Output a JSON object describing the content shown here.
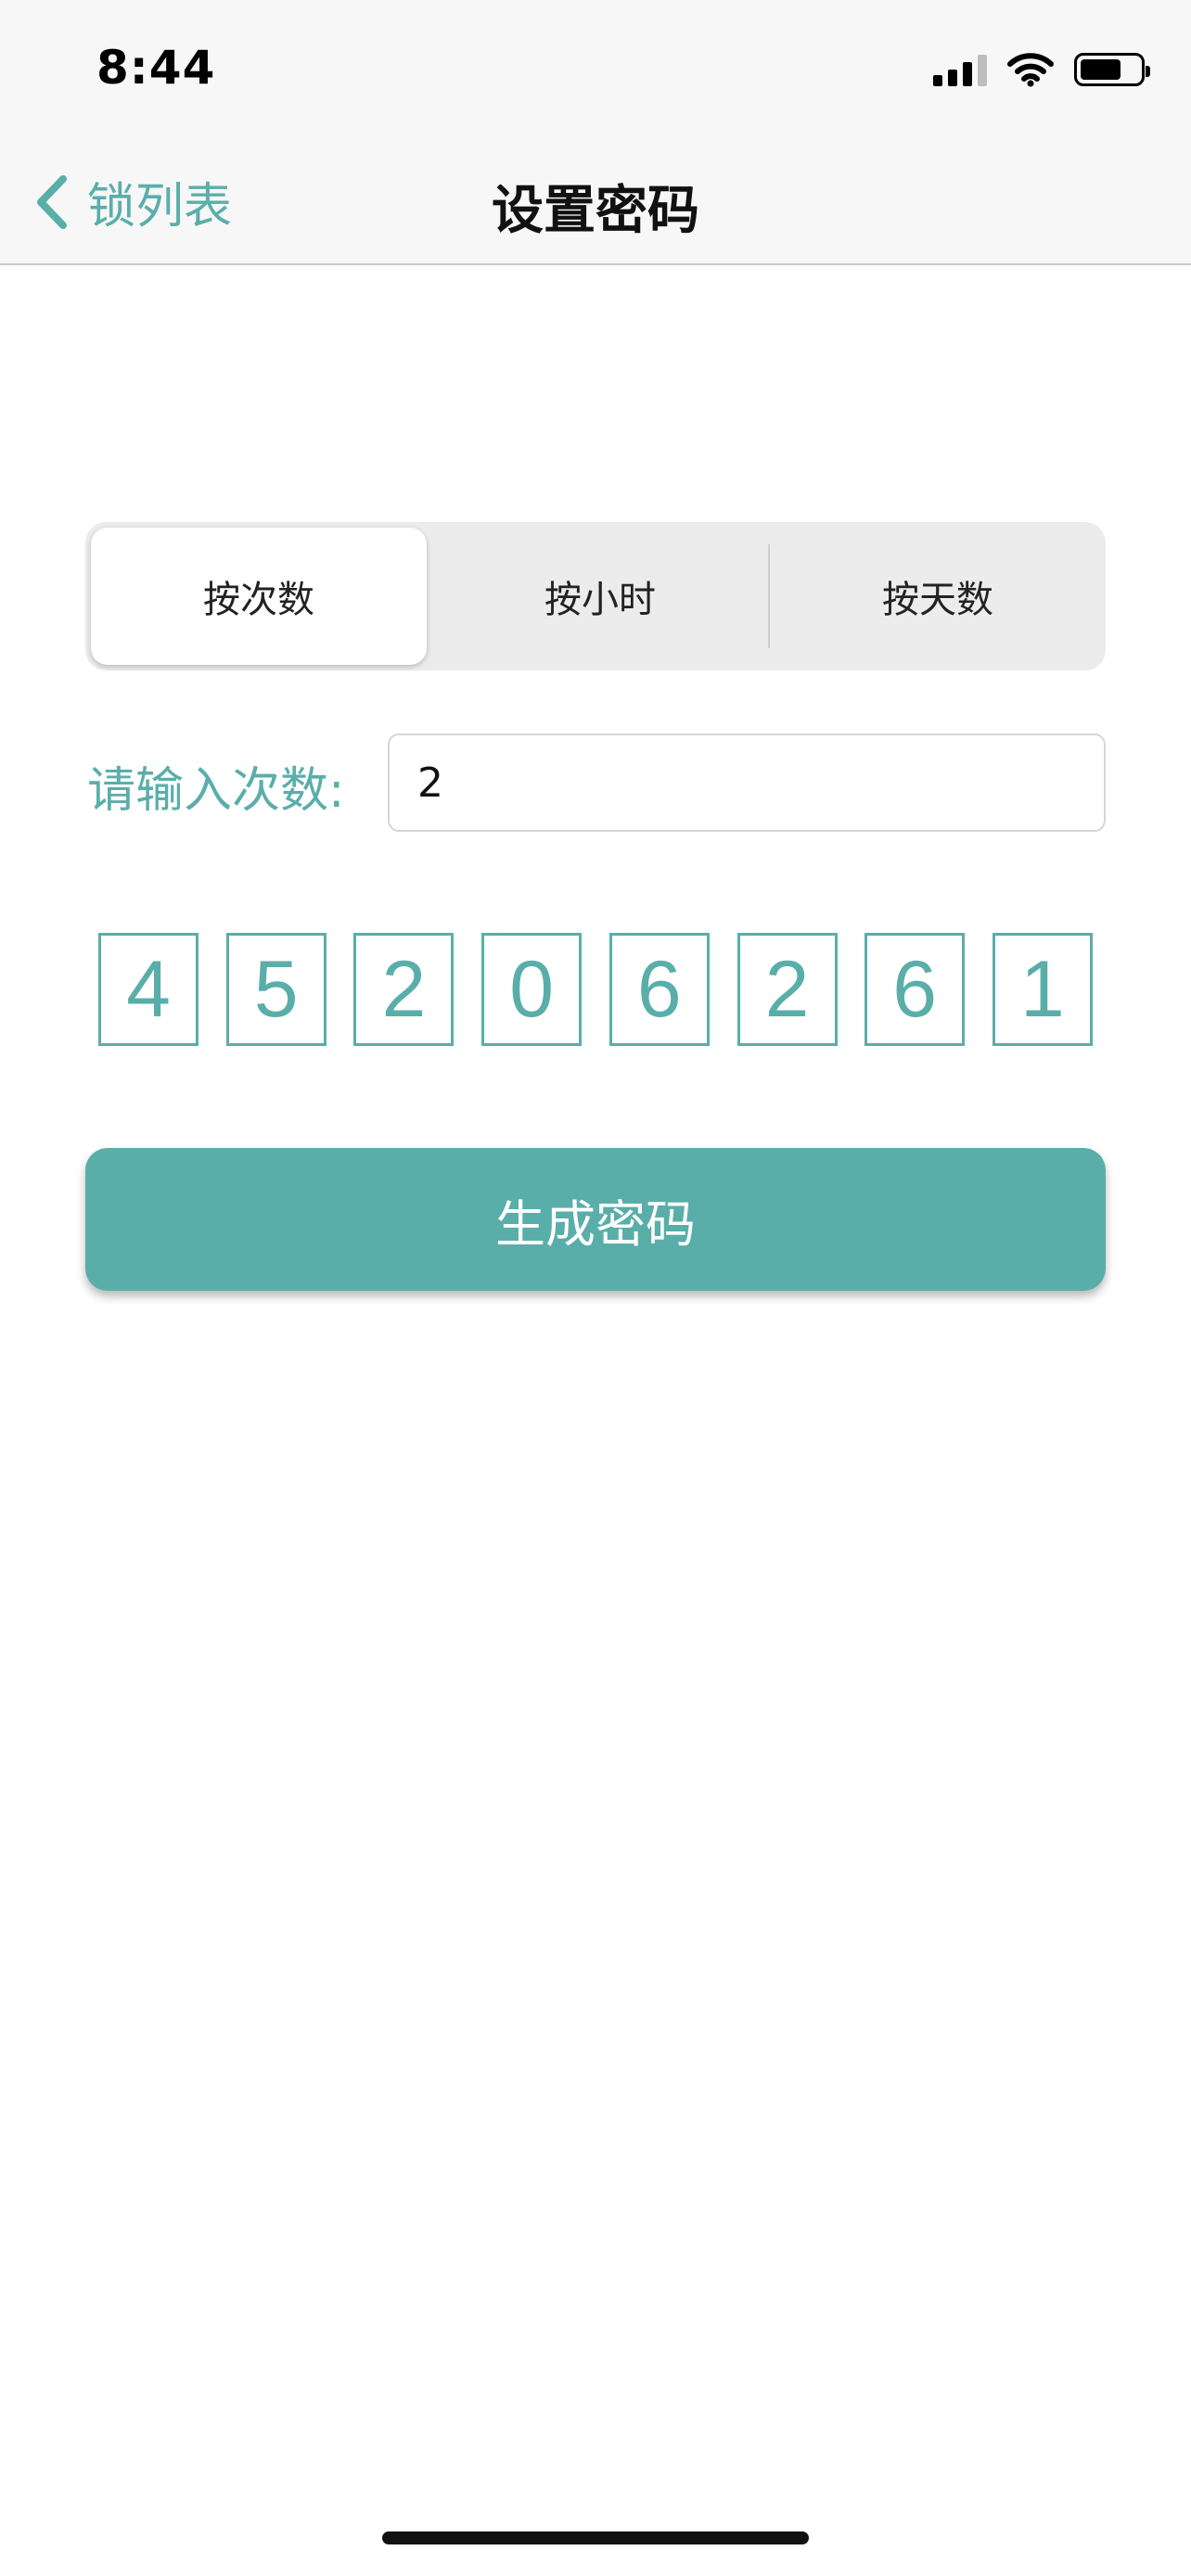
{
  "status_bar": {
    "time": "8:44",
    "icons": [
      "cellular-signal-icon",
      "wifi-icon",
      "battery-icon"
    ]
  },
  "nav": {
    "back_label": "锁列表",
    "title": "设置密码"
  },
  "segmented": {
    "items": [
      {
        "label": "按次数",
        "selected": true
      },
      {
        "label": "按小时",
        "selected": false
      },
      {
        "label": "按天数",
        "selected": false
      }
    ]
  },
  "count_field": {
    "label": "请输入次数:",
    "value": "2"
  },
  "code": {
    "digits": [
      "4",
      "5",
      "2",
      "0",
      "6",
      "2",
      "6",
      "1"
    ]
  },
  "actions": {
    "generate_label": "生成密码"
  },
  "colors": {
    "accent": "#5aaea9",
    "nav_background": "#f7f7f7",
    "segment_background": "#ececec"
  }
}
